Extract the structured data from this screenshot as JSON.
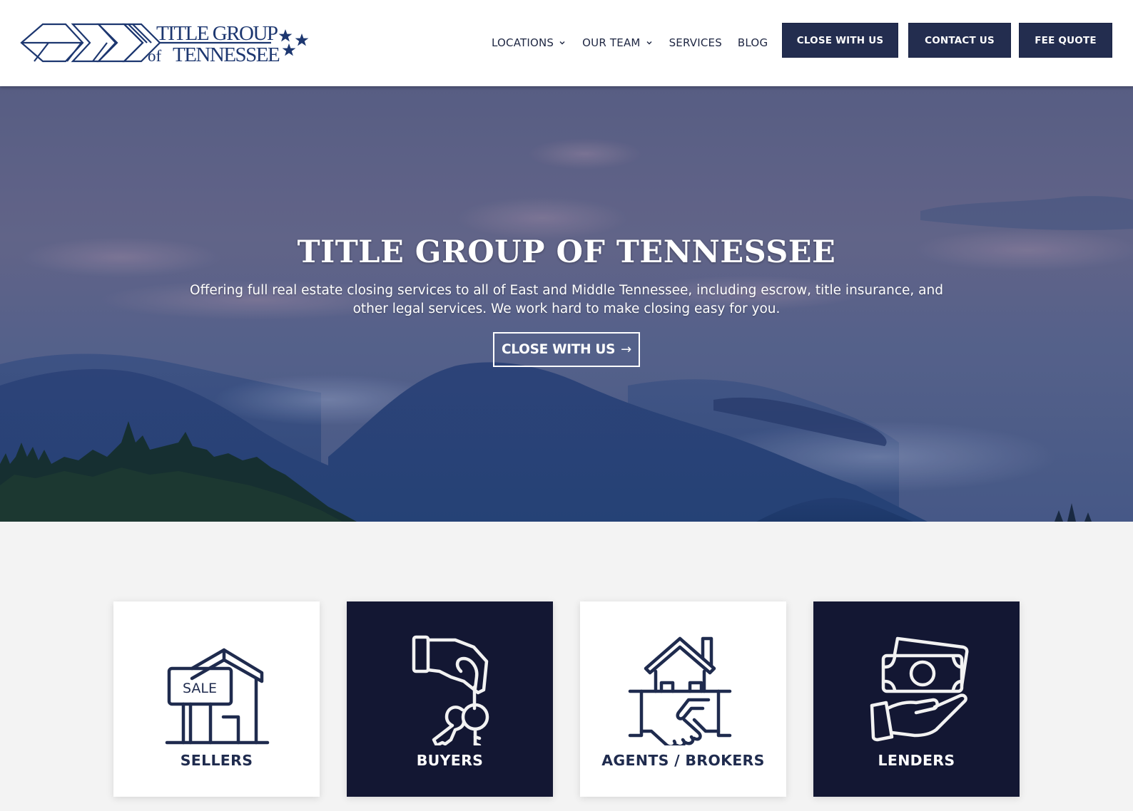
{
  "header": {
    "logo": {
      "line1": "TITLE GROUP",
      "line2_prefix": "of",
      "line2": "TENNESSEE",
      "alt": "Title Group of Tennessee logo"
    },
    "nav": [
      {
        "label": "LOCATIONS",
        "has_dropdown": true
      },
      {
        "label": "OUR TEAM",
        "has_dropdown": true
      },
      {
        "label": "SERVICES",
        "has_dropdown": false
      },
      {
        "label": "BLOG",
        "has_dropdown": false
      }
    ],
    "buttons": [
      {
        "label": "CLOSE WITH US"
      },
      {
        "label": "CONTACT US"
      },
      {
        "label": "FEE QUOTE"
      }
    ]
  },
  "hero": {
    "title": "TITLE GROUP OF TENNESSEE",
    "subtitle": "Offering full real estate closing services to all of East and Middle Tennessee, including escrow, title insurance, and other legal services. We work hard to make closing easy for you.",
    "cta_label": "CLOSE WITH US",
    "cta_arrow": "→"
  },
  "cards": [
    {
      "label": "SELLERS",
      "icon": "sale-sign-house-icon",
      "sign_text": "SALE",
      "theme": "light"
    },
    {
      "label": "BUYERS",
      "icon": "hand-keys-icon",
      "theme": "dark"
    },
    {
      "label": "AGENTS / BROKERS",
      "icon": "house-handshake-icon",
      "theme": "light"
    },
    {
      "label": "LENDERS",
      "icon": "hand-money-icon",
      "theme": "dark"
    }
  ],
  "colors": {
    "brand_navy": "#232d4f",
    "logo_blue": "#1d3770",
    "card_dark": "#131733",
    "card_light_icon": "#1f2b4e",
    "page_bg": "#f3f3f3"
  }
}
